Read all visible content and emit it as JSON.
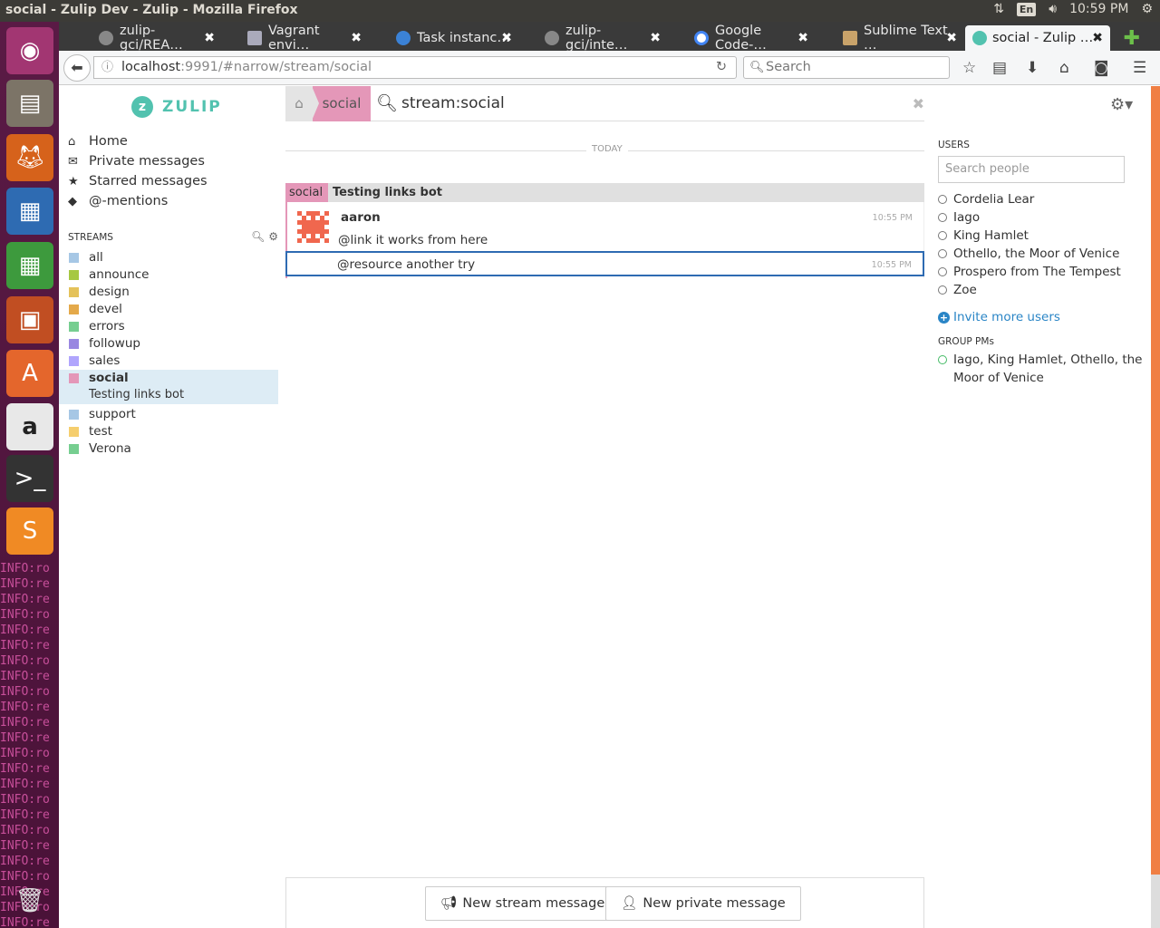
{
  "desktop": {
    "window_title": "social - Zulip Dev - Zulip - Mozilla Firefox",
    "keyboard_layout": "En",
    "clock": "10:59 PM",
    "terminal_lines": [
      "INFO:ro",
      "INFO:re",
      "INFO:re",
      "INFO:ro",
      "INFO:re",
      "INFO:re",
      "INFO:ro",
      "INFO:re",
      "INFO:ro",
      "INFO:re",
      "INFO:re",
      "INFO:re",
      "INFO:ro",
      "INFO:re",
      "INFO:re",
      "INFO:ro",
      "INFO:re",
      "INFO:ro",
      "INFO:re",
      "INFO:re",
      "INFO:ro",
      "INFO:re",
      "INFO:ro",
      "INFO:re"
    ]
  },
  "browser": {
    "tabs": [
      {
        "label": "zulip-gci/REA…",
        "icon": "github-icon"
      },
      {
        "label": "Vagrant envi…",
        "icon": "doc-icon"
      },
      {
        "label": "Task instanc…",
        "icon": "gear-icon"
      },
      {
        "label": "zulip-gci/inte…",
        "icon": "github-icon"
      },
      {
        "label": "Google Code-…",
        "icon": "google-icon"
      },
      {
        "label": "Sublime Text …",
        "icon": "sublime-icon"
      },
      {
        "label": "social - Zulip …",
        "icon": "zulip-icon",
        "active": true
      }
    ],
    "url_host": "localhost",
    "url_rest": ":9991/#narrow/stream/social",
    "search_placeholder": "Search"
  },
  "zulip": {
    "logo_text": "ZULIP",
    "narrow": {
      "stream": "social",
      "search": "stream:social"
    },
    "nav": [
      {
        "label": "Home",
        "icon": "home-icon"
      },
      {
        "label": "Private messages",
        "icon": "envelope-icon"
      },
      {
        "label": "Starred messages",
        "icon": "star-icon"
      },
      {
        "label": "@-mentions",
        "icon": "tag-icon"
      }
    ],
    "streams_header": "STREAMS",
    "streams": [
      {
        "name": "all",
        "color": "#a6c7e5"
      },
      {
        "name": "announce",
        "color": "#a6c842"
      },
      {
        "name": "design",
        "color": "#e4c25a"
      },
      {
        "name": "devel",
        "color": "#e4a94a"
      },
      {
        "name": "errors",
        "color": "#76ce90"
      },
      {
        "name": "followup",
        "color": "#9987e1"
      },
      {
        "name": "sales",
        "color": "#b0a5fd"
      },
      {
        "name": "social",
        "color": "#e497b8",
        "active": true,
        "topic": "Testing links bot"
      },
      {
        "name": "support",
        "color": "#a6c7e5"
      },
      {
        "name": "test",
        "color": "#f5ce6e"
      },
      {
        "name": "Verona",
        "color": "#76ce90"
      }
    ],
    "today_label": "TODAY",
    "recipient": {
      "stream": "social",
      "topic": "Testing links bot"
    },
    "messages": [
      {
        "sender": "aaron",
        "content": "@link it works from here",
        "time": "10:55 PM"
      },
      {
        "content": "@resource another try",
        "time": "10:55 PM"
      }
    ],
    "compose": {
      "new_stream": "New stream message",
      "new_private": "New private message"
    },
    "users_header": "USERS",
    "search_people_placeholder": "Search people",
    "users": [
      "Cordelia Lear",
      "Iago",
      "King Hamlet",
      "Othello, the Moor of Venice",
      "Prospero from The Tempest",
      "Zoe"
    ],
    "invite_label": "Invite more users",
    "group_pms_header": "GROUP PMs",
    "group_pm": "Iago, King Hamlet, Othello, the Moor of Venice"
  }
}
